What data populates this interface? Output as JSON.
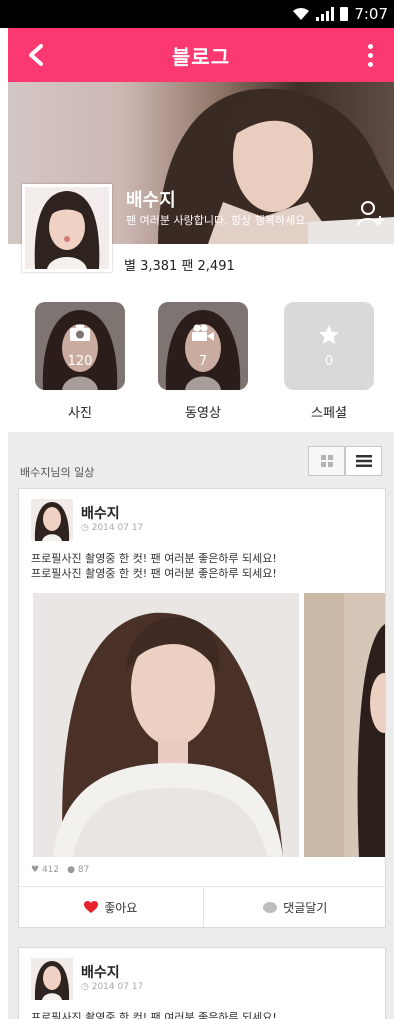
{
  "status_bar": {
    "time": "7:07"
  },
  "app_bar": {
    "title": "블로그"
  },
  "profile": {
    "name": "배수지",
    "description": "팬 여러분 사랑합니다. 항상 행복하세요.",
    "stats": "별 3,381 팬 2,491"
  },
  "media": [
    {
      "label": "사진",
      "count": "120",
      "icon": "camera-icon"
    },
    {
      "label": "동영상",
      "count": "7",
      "icon": "video-camera-icon"
    },
    {
      "label": "스페셜",
      "count": "0",
      "icon": "star-icon"
    }
  ],
  "feed": {
    "title": "배수지님의 일상",
    "posts": [
      {
        "author": "배수지",
        "date": "2014 07 17",
        "text_line1": "프로필사진 촬영중 한 컷! 팬 여러분 좋은하루 되세요!",
        "text_line2": "프로필사진 촬영중 한 컷! 팬 여러분 좋은하루 되세요!",
        "likes": "412",
        "comments": "87",
        "like_label": "좋아요",
        "comment_label": "댓글달기"
      },
      {
        "author": "배수지",
        "date": "2014 07 17",
        "text_line1": "프로필사진 촬영중 한 컷! 팬 여러분 좋은하루 되세요!"
      }
    ]
  },
  "colors": {
    "accent": "#fb3870",
    "like": "#e8232f",
    "feed_bg": "#ececec"
  }
}
